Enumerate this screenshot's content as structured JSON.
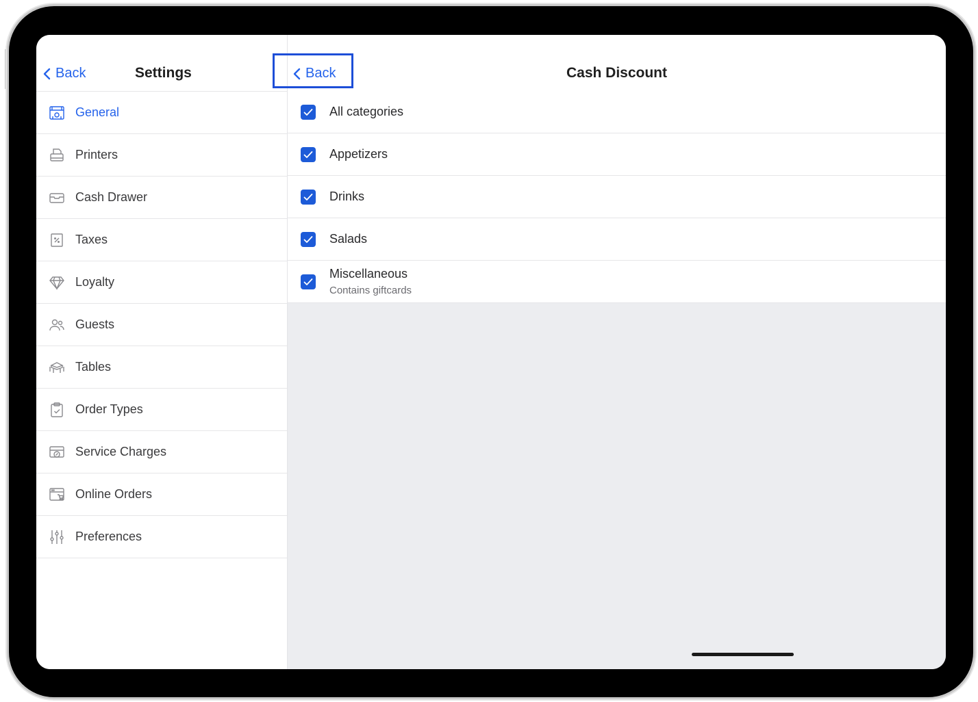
{
  "left_panel": {
    "back_label": "Back",
    "title": "Settings",
    "items": [
      {
        "label": "General",
        "icon": "store-icon",
        "active": true
      },
      {
        "label": "Printers",
        "icon": "printer-icon"
      },
      {
        "label": "Cash Drawer",
        "icon": "cash-drawer-icon"
      },
      {
        "label": "Taxes",
        "icon": "tax-icon"
      },
      {
        "label": "Loyalty",
        "icon": "diamond-icon"
      },
      {
        "label": "Guests",
        "icon": "guests-icon"
      },
      {
        "label": "Tables",
        "icon": "table-icon"
      },
      {
        "label": "Order Types",
        "icon": "clipboard-check-icon"
      },
      {
        "label": "Service Charges",
        "icon": "service-charge-icon"
      },
      {
        "label": "Online Orders",
        "icon": "online-order-icon"
      },
      {
        "label": "Preferences",
        "icon": "sliders-icon"
      }
    ]
  },
  "right_panel": {
    "back_label": "Back",
    "title": "Cash Discount",
    "categories": [
      {
        "label": "All categories",
        "checked": true
      },
      {
        "label": "Appetizers",
        "checked": true
      },
      {
        "label": "Drinks",
        "checked": true
      },
      {
        "label": "Salads",
        "checked": true
      },
      {
        "label": "Miscellaneous",
        "sublabel": "Contains giftcards",
        "checked": true
      }
    ]
  },
  "colors": {
    "accent": "#2563eb",
    "checkbox": "#1d5bd8",
    "highlight_box": "#1d4ed8",
    "empty_area": "#ecedf0"
  }
}
